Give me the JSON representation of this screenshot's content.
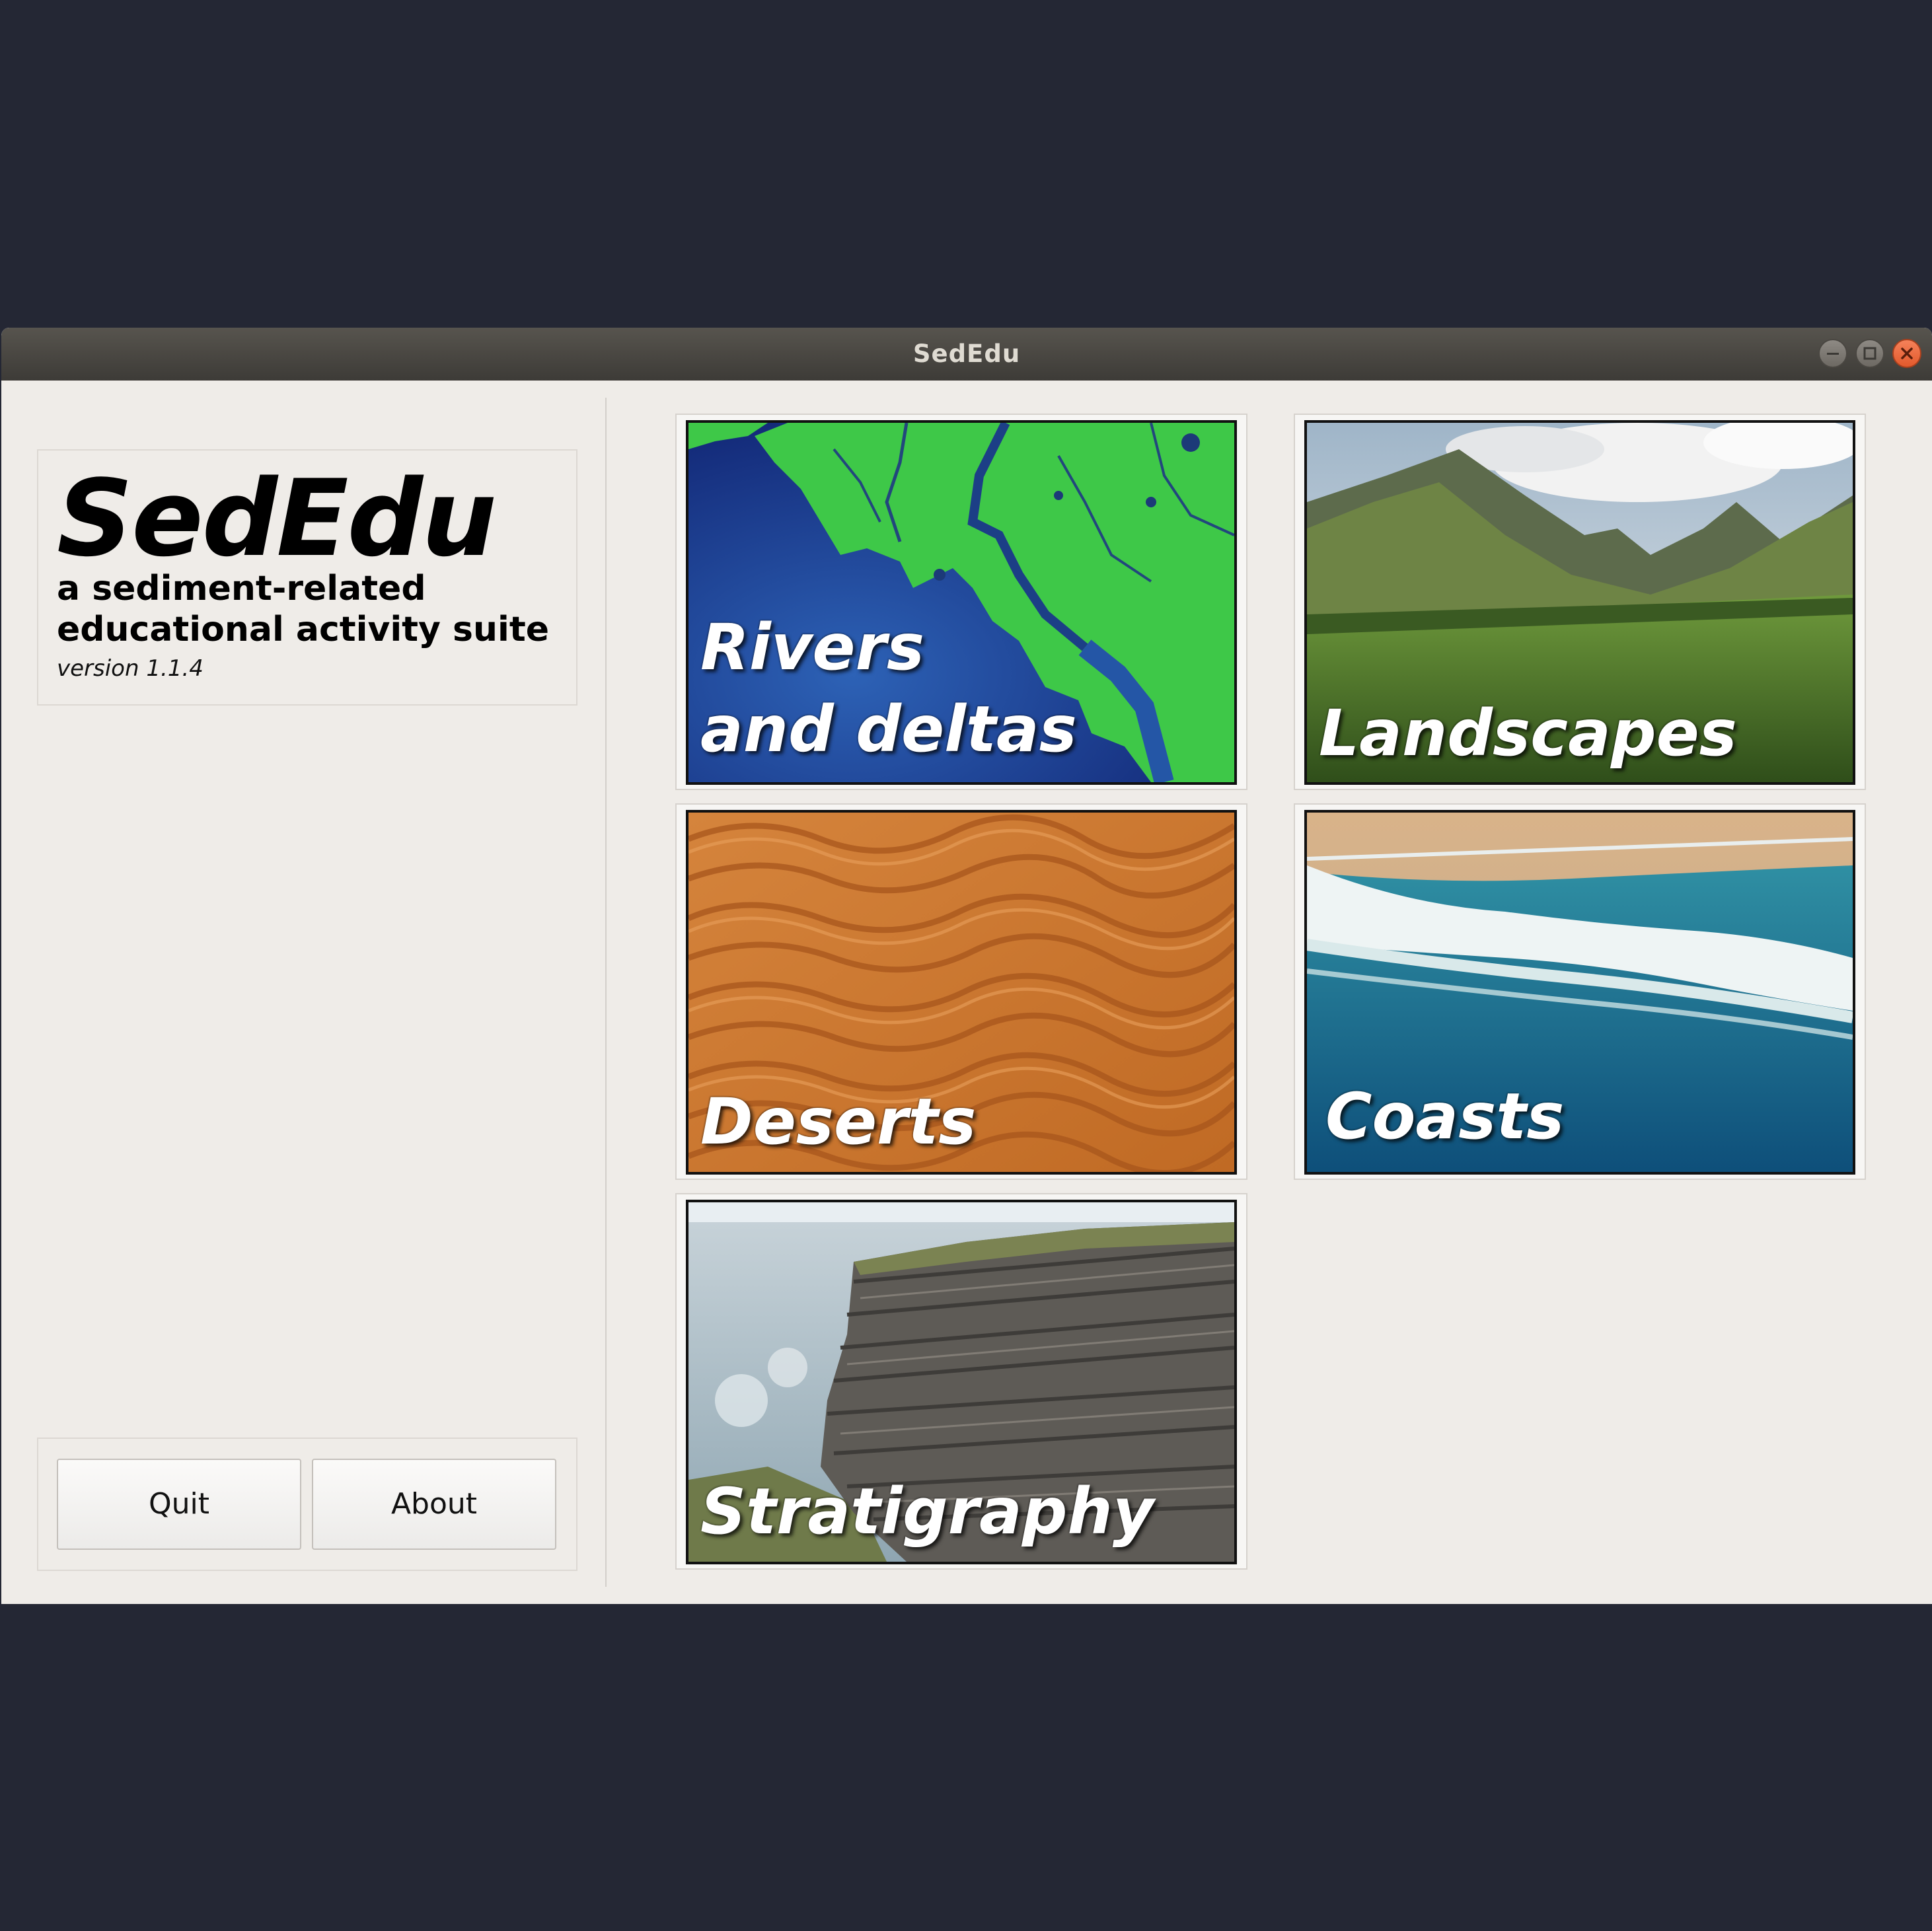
{
  "window": {
    "title": "SedEdu"
  },
  "info": {
    "app_title": "SedEdu",
    "subtitle": "a sediment-related\neducational activity suite",
    "version": "version 1.1.4"
  },
  "buttons": {
    "quit_label": "Quit",
    "about_label": "About"
  },
  "modules": [
    {
      "label": "Rivers\nand deltas",
      "image": "delta-satellite-image"
    },
    {
      "label": "Landscapes",
      "image": "mountain-valley-image"
    },
    {
      "label": "Deserts",
      "image": "sand-ripples-image"
    },
    {
      "label": "Coasts",
      "image": "ocean-waves-image"
    },
    {
      "label": "Stratigraphy",
      "image": "layered-cliff-image"
    }
  ],
  "colors": {
    "desktop_bg": "#242734",
    "window_bg": "#efece8",
    "titlebar": "#4a4742",
    "close_button": "#e95420"
  },
  "icons": {
    "minimize": "minimize-icon",
    "maximize": "maximize-icon",
    "close": "close-icon"
  }
}
